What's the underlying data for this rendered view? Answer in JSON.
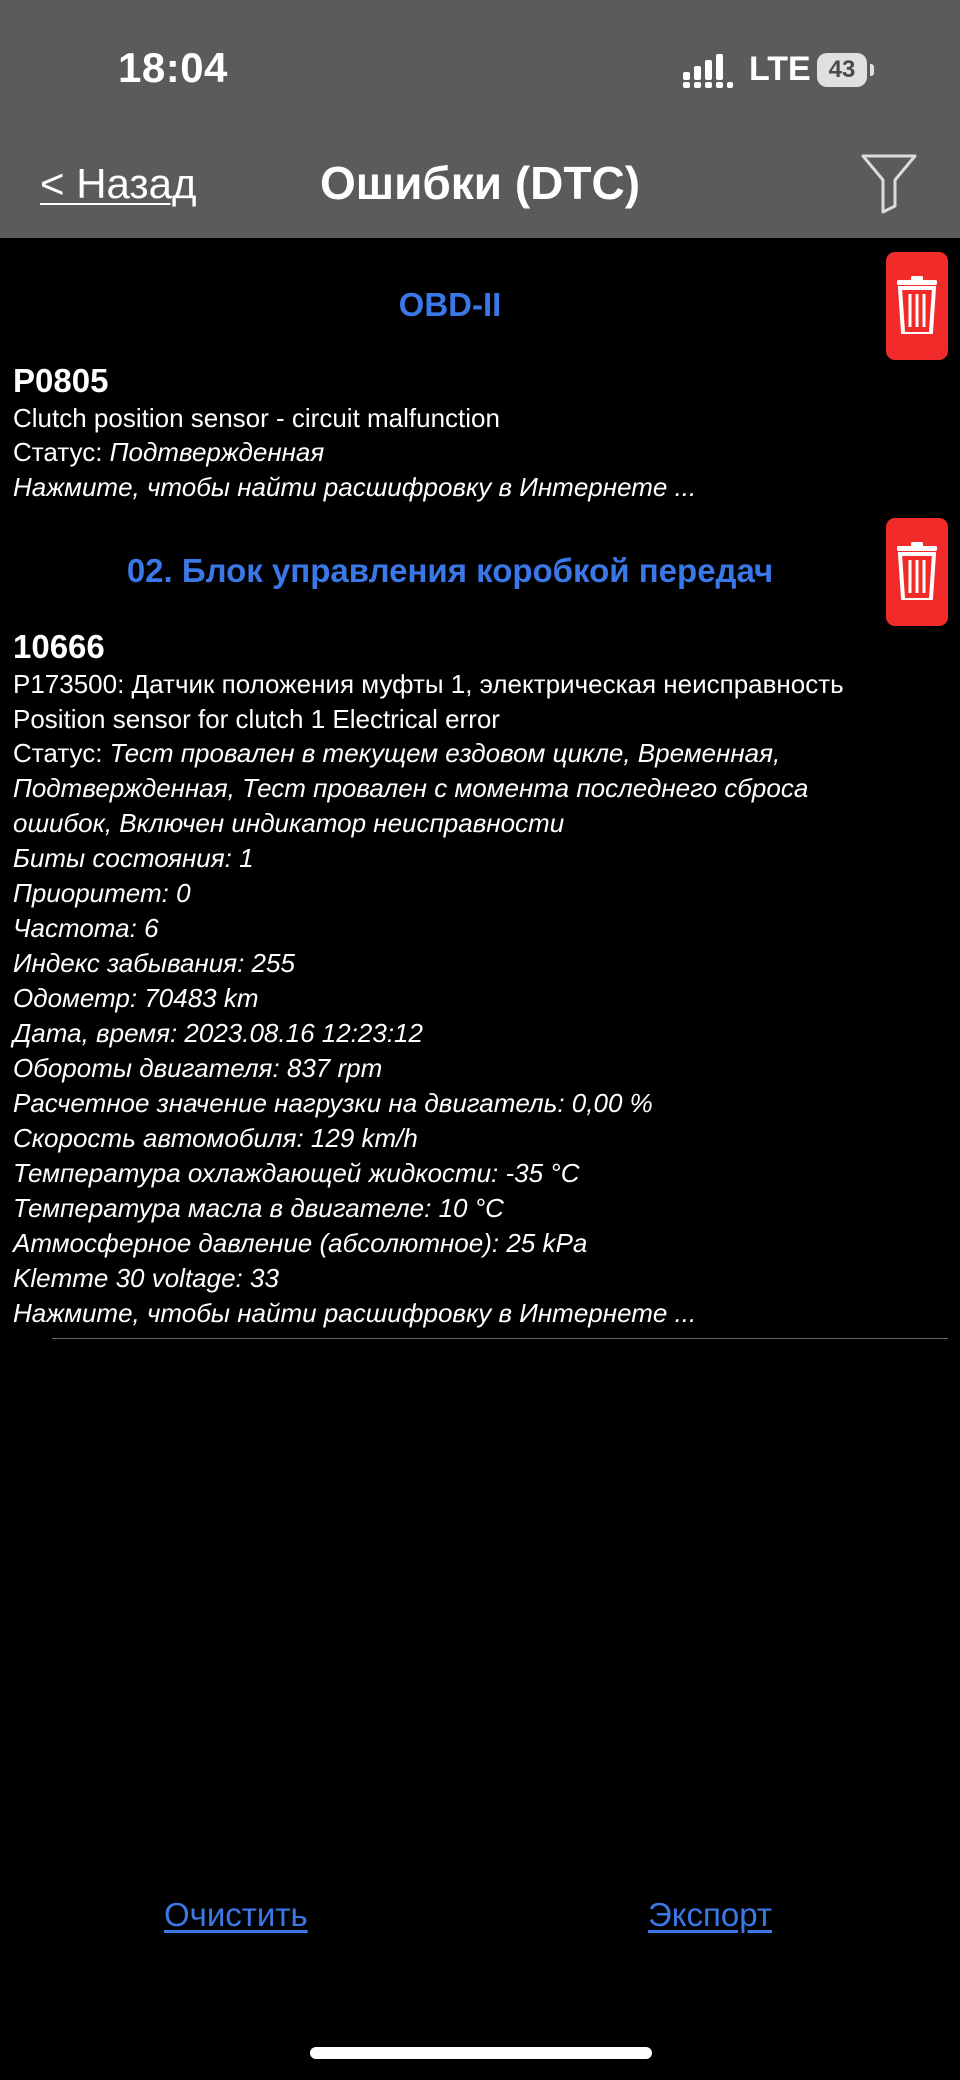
{
  "status_bar": {
    "time": "18:04",
    "network": "LTE",
    "battery": "43"
  },
  "nav": {
    "back_label": "< Назад",
    "title": "Ошибки (DTC)",
    "filter_icon": "filter-icon"
  },
  "sections": [
    {
      "header": "OBD-II",
      "delete_icon": "trash-icon",
      "dtc": {
        "code": "P0805",
        "description": "Clutch position sensor - circuit malfunction",
        "status_label": "Статус: ",
        "status_value": "Подтвержденная",
        "search_hint": "Нажмите, чтобы найти расшифровку в Интернете ..."
      }
    },
    {
      "header": "02. Блок управления коробкой передач",
      "delete_icon": "trash-icon",
      "dtc": {
        "code": "10666",
        "description_ru": "P173500: Датчик положения муфты 1, электрическая неисправность",
        "description_en": "Position sensor for clutch 1 Electrical error",
        "status_label": "Статус: ",
        "status_lines": [
          "Тест провален в текущем ездовом цикле, Временная,",
          "Подтвержденная, Тест провален с момента последнего сброса",
          "ошибок, Включен индикатор неисправности"
        ],
        "details": [
          "Биты состояния: 1",
          "Приоритет: 0",
          "Частота: 6",
          "Индекс забывания: 255",
          "Одометр: 70483 km",
          "Дата, время: 2023.08.16 12:23:12",
          "Обороты двигателя: 837 rpm",
          "Расчетное значение нагрузки на двигатель: 0,00 %",
          "Скорость автомобиля: 129 km/h",
          "Температура охлаждающей жидкости: -35 °C",
          "Температура масла в двигателе: 10 °C",
          "Атмосферное давление (абсолютное): 25 kPa",
          "Klemme 30 voltage: 33"
        ],
        "search_hint": "Нажмите, чтобы найти расшифровку в Интернете ..."
      }
    }
  ],
  "footer": {
    "clear_label": "Очистить",
    "export_label": "Экспорт"
  },
  "colors": {
    "accent": "#3b78e7",
    "delete": "#f12a2a",
    "top_bar": "#5b5b5b",
    "background": "#000000"
  }
}
